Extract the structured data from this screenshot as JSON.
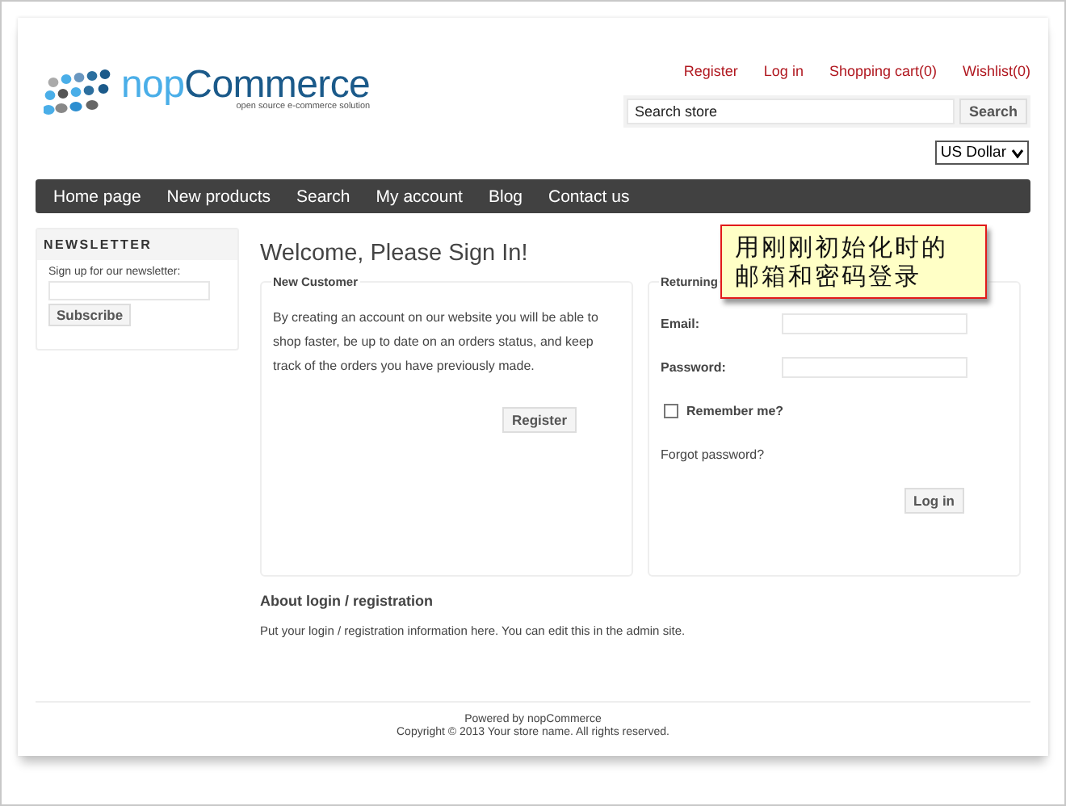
{
  "logo": {
    "prefix": "nop",
    "name": "Commerce",
    "tagline": "open source e-commerce solution"
  },
  "header_links": [
    "Register",
    "Log in",
    "Shopping cart(0)",
    "Wishlist(0)"
  ],
  "search": {
    "value": "Search store",
    "button": "Search"
  },
  "currency": {
    "value": "US Dollar"
  },
  "nav": [
    "Home page",
    "New products",
    "Search",
    "My account",
    "Blog",
    "Contact us"
  ],
  "newsletter": {
    "title": "NEWSLETTER",
    "label": "Sign up for our newsletter:",
    "button": "Subscribe"
  },
  "page_title": "Welcome, Please Sign In!",
  "new_customer": {
    "legend": "New Customer",
    "text": "By creating an account on our website you will be able to shop faster, be up to date on an orders status, and keep track of the orders you have previously made.",
    "button": "Register"
  },
  "returning_customer": {
    "legend": "Returning",
    "email_label": "Email:",
    "password_label": "Password:",
    "remember": {
      "label": "Remember me?",
      "checked": false
    },
    "forgot": "Forgot password?",
    "button": "Log in"
  },
  "callout": "用刚刚初始化时的邮箱和密码登录",
  "about": {
    "title": "About login / registration",
    "text": "Put your login / registration information here. You can edit this in the admin site."
  },
  "footer": [
    "Powered by nopCommerce",
    "Copyright © 2013 Your store name. All rights reserved."
  ]
}
